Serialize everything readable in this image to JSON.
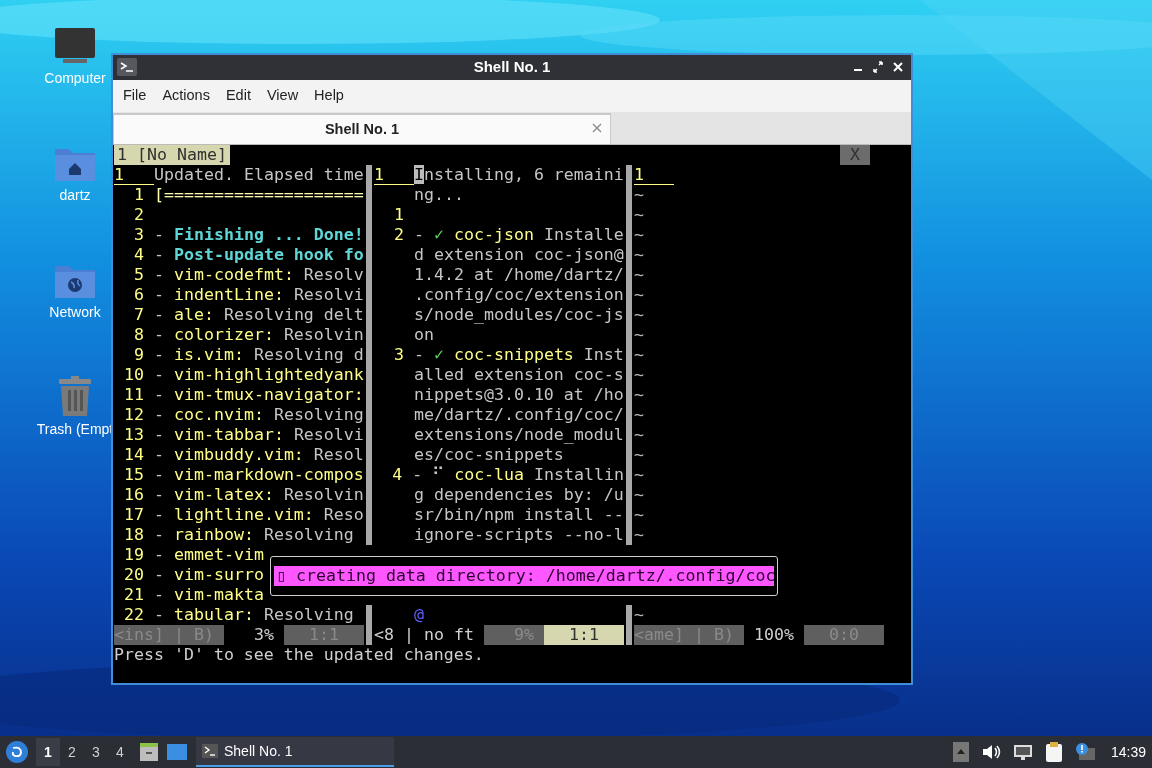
{
  "desktop": {
    "icons": [
      {
        "label": "Computer",
        "kind": "computer"
      },
      {
        "label": "dartz",
        "kind": "home"
      },
      {
        "label": "Network",
        "kind": "network"
      },
      {
        "label": "Trash (Empt",
        "kind": "trash"
      }
    ]
  },
  "window": {
    "title": "Shell No. 1",
    "menu": [
      "File",
      "Actions",
      "Edit",
      "View",
      "Help"
    ],
    "tabs": [
      {
        "label": "Shell No. 1",
        "selected": true
      }
    ],
    "terminal": {
      "tabline": {
        "label": "1 [No Name]",
        "close": "X"
      },
      "panes": [
        {
          "lines": [
            {
              "number": "1",
              "current": true,
              "segments": [
                {
                  "text": "Updated. Elapsed time",
                  "kind": "plain"
                }
              ]
            },
            {
              "number": "1",
              "current": false,
              "segments": [
                {
                  "text": "[====================",
                  "kind": "progress"
                }
              ]
            },
            {
              "number": "2",
              "current": false
            },
            {
              "number": "3",
              "current": false,
              "segments": [
                {
                  "text": "- ",
                  "kind": "plain"
                },
                {
                  "text": "Finishing ... Done!",
                  "kind": "bold"
                }
              ]
            },
            {
              "number": "4",
              "current": false,
              "segments": [
                {
                  "text": "- ",
                  "kind": "plain"
                },
                {
                  "text": "Post-update hook fo",
                  "kind": "bold"
                }
              ]
            },
            {
              "number": "5",
              "current": false,
              "segments": [
                {
                  "text": "- ",
                  "kind": "plain"
                },
                {
                  "text": "vim-codefmt:",
                  "kind": "name"
                },
                {
                  "text": " Resolv",
                  "kind": "plain"
                }
              ]
            },
            {
              "number": "6",
              "current": false,
              "segments": [
                {
                  "text": "- ",
                  "kind": "plain"
                },
                {
                  "text": "indentLine:",
                  "kind": "name"
                },
                {
                  "text": " Resolvi",
                  "kind": "plain"
                }
              ]
            },
            {
              "number": "7",
              "current": false,
              "segments": [
                {
                  "text": "- ",
                  "kind": "plain"
                },
                {
                  "text": "ale:",
                  "kind": "name"
                },
                {
                  "text": " Resolving delt",
                  "kind": "plain"
                }
              ]
            },
            {
              "number": "8",
              "current": false,
              "segments": [
                {
                  "text": "- ",
                  "kind": "plain"
                },
                {
                  "text": "colorizer:",
                  "kind": "name"
                },
                {
                  "text": " Resolvin",
                  "kind": "plain"
                }
              ]
            },
            {
              "number": "9",
              "current": false,
              "segments": [
                {
                  "text": "- ",
                  "kind": "plain"
                },
                {
                  "text": "is.vim:",
                  "kind": "name"
                },
                {
                  "text": " Resolving d",
                  "kind": "plain"
                }
              ]
            },
            {
              "number": "10",
              "current": false,
              "segments": [
                {
                  "text": "- ",
                  "kind": "plain"
                },
                {
                  "text": "vim-highlightedyank",
                  "kind": "name"
                }
              ]
            },
            {
              "number": "11",
              "current": false,
              "segments": [
                {
                  "text": "- ",
                  "kind": "plain"
                },
                {
                  "text": "vim-tmux-navigator:",
                  "kind": "name"
                }
              ]
            },
            {
              "number": "12",
              "current": false,
              "segments": [
                {
                  "text": "- ",
                  "kind": "plain"
                },
                {
                  "text": "coc.nvim:",
                  "kind": "name"
                },
                {
                  "text": " Resolving",
                  "kind": "plain"
                }
              ]
            },
            {
              "number": "13",
              "current": false,
              "segments": [
                {
                  "text": "- ",
                  "kind": "plain"
                },
                {
                  "text": "vim-tabbar:",
                  "kind": "name"
                },
                {
                  "text": " Resolvi",
                  "kind": "plain"
                }
              ]
            },
            {
              "number": "14",
              "current": false,
              "segments": [
                {
                  "text": "- ",
                  "kind": "plain"
                },
                {
                  "text": "vimbuddy.vim:",
                  "kind": "name"
                },
                {
                  "text": " Resol",
                  "kind": "plain"
                }
              ]
            },
            {
              "number": "15",
              "current": false,
              "segments": [
                {
                  "text": "- ",
                  "kind": "plain"
                },
                {
                  "text": "vim-markdown-compos",
                  "kind": "name"
                }
              ]
            },
            {
              "number": "16",
              "current": false,
              "segments": [
                {
                  "text": "- ",
                  "kind": "plain"
                },
                {
                  "text": "vim-latex:",
                  "kind": "name"
                },
                {
                  "text": " Resolvin",
                  "kind": "plain"
                }
              ]
            },
            {
              "number": "17",
              "current": false,
              "segments": [
                {
                  "text": "- ",
                  "kind": "plain"
                },
                {
                  "text": "lightline.vim:",
                  "kind": "name"
                },
                {
                  "text": " Reso",
                  "kind": "plain"
                }
              ]
            },
            {
              "number": "18",
              "current": false,
              "segments": [
                {
                  "text": "- ",
                  "kind": "plain"
                },
                {
                  "text": "rainbow:",
                  "kind": "name"
                },
                {
                  "text": " Resolving",
                  "kind": "plain"
                }
              ]
            },
            {
              "number": "19",
              "current": false,
              "segments": [
                {
                  "text": "- ",
                  "kind": "plain"
                },
                {
                  "text": "emmet-vim",
                  "kind": "name"
                }
              ]
            },
            {
              "number": "20",
              "current": false,
              "segments": [
                {
                  "text": "- ",
                  "kind": "plain"
                },
                {
                  "text": "vim-surro",
                  "kind": "name"
                }
              ]
            },
            {
              "number": "21",
              "current": false,
              "segments": [
                {
                  "text": "- ",
                  "kind": "plain"
                },
                {
                  "text": "vim-makta",
                  "kind": "name"
                }
              ]
            },
            {
              "number": "22",
              "current": false,
              "segments": [
                {
                  "text": "- ",
                  "kind": "plain"
                },
                {
                  "text": "tabular:",
                  "kind": "name"
                },
                {
                  "text": " Resolving",
                  "kind": "plain"
                }
              ]
            }
          ]
        },
        {
          "lines": [
            {
              "number": "1",
              "current": true,
              "segments": [
                {
                  "text": "I",
                  "kind": "cursor"
                },
                {
                  "text": "nstalling, 6 remaini",
                  "kind": "plain"
                }
              ]
            },
            {
              "segments": [
                {
                  "text": "ng...",
                  "kind": "plain"
                }
              ]
            },
            {
              "number": "1",
              "current": false
            },
            {
              "number": "2",
              "current": false,
              "segments": [
                {
                  "text": "- ",
                  "kind": "plain"
                },
                {
                  "text": "✓",
                  "kind": "check"
                },
                {
                  "text": " coc-json",
                  "kind": "name"
                },
                {
                  "text": " Installe",
                  "kind": "plain"
                }
              ]
            },
            {
              "segments": [
                {
                  "text": "d extension coc-json@",
                  "kind": "plain"
                }
              ]
            },
            {
              "segments": [
                {
                  "text": "1.4.2 at /home/dartz/",
                  "kind": "plain"
                }
              ]
            },
            {
              "segments": [
                {
                  "text": ".config/coc/extension",
                  "kind": "plain"
                }
              ]
            },
            {
              "segments": [
                {
                  "text": "s/node_modules/coc-js",
                  "kind": "plain"
                }
              ]
            },
            {
              "segments": [
                {
                  "text": "on",
                  "kind": "plain"
                }
              ]
            },
            {
              "number": "3",
              "current": false,
              "segments": [
                {
                  "text": "- ",
                  "kind": "plain"
                },
                {
                  "text": "✓",
                  "kind": "check"
                },
                {
                  "text": " coc-snippets",
                  "kind": "name"
                },
                {
                  "text": " Inst",
                  "kind": "plain"
                }
              ]
            },
            {
              "segments": [
                {
                  "text": "alled extension coc-s",
                  "kind": "plain"
                }
              ]
            },
            {
              "segments": [
                {
                  "text": "nippets@3.0.10 at /ho",
                  "kind": "plain"
                }
              ]
            },
            {
              "segments": [
                {
                  "text": "me/dartz/.config/coc/",
                  "kind": "plain"
                }
              ]
            },
            {
              "segments": [
                {
                  "text": "extensions/node_modul",
                  "kind": "plain"
                }
              ]
            },
            {
              "segments": [
                {
                  "text": "es/coc-snippets",
                  "kind": "plain"
                }
              ]
            },
            {
              "number": "4",
              "current": false,
              "segments": [
                {
                  "text": "- ⠋",
                  "kind": "plain"
                },
                {
                  "text": " coc-lua",
                  "kind": "name"
                },
                {
                  "text": " Installin",
                  "kind": "plain"
                }
              ]
            },
            {
              "segments": [
                {
                  "text": "g dependencies by: /u",
                  "kind": "plain"
                }
              ]
            },
            {
              "segments": [
                {
                  "text": "sr/bin/npm install --",
                  "kind": "plain"
                }
              ]
            },
            {
              "segments": [
                {
                  "text": "ignore-scripts --no-l",
                  "kind": "plain"
                }
              ]
            },
            {
              "segments": [
                {
                  "text": "@",
                  "kind": "at"
                }
              ]
            }
          ]
        },
        {
          "lines": [
            {
              "number": "1",
              "current": true
            },
            {
              "segments": [
                {
                  "text": "~",
                  "kind": "filler"
                }
              ]
            },
            {
              "segments": [
                {
                  "text": "~",
                  "kind": "filler"
                }
              ]
            },
            {
              "segments": [
                {
                  "text": "~",
                  "kind": "filler"
                }
              ]
            },
            {
              "segments": [
                {
                  "text": "~",
                  "kind": "filler"
                }
              ]
            },
            {
              "segments": [
                {
                  "text": "~",
                  "kind": "filler"
                }
              ]
            },
            {
              "segments": [
                {
                  "text": "~",
                  "kind": "filler"
                }
              ]
            },
            {
              "segments": [
                {
                  "text": "~",
                  "kind": "filler"
                }
              ]
            },
            {
              "segments": [
                {
                  "text": "~",
                  "kind": "filler"
                }
              ]
            },
            {
              "segments": [
                {
                  "text": "~",
                  "kind": "filler"
                }
              ]
            },
            {
              "segments": [
                {
                  "text": "~",
                  "kind": "filler"
                }
              ]
            },
            {
              "segments": [
                {
                  "text": "~",
                  "kind": "filler"
                }
              ]
            },
            {
              "segments": [
                {
                  "text": "~",
                  "kind": "filler"
                }
              ]
            },
            {
              "segments": [
                {
                  "text": "~",
                  "kind": "filler"
                }
              ]
            },
            {
              "segments": [
                {
                  "text": "~",
                  "kind": "filler"
                }
              ]
            },
            {
              "segments": [
                {
                  "text": "~",
                  "kind": "filler"
                }
              ]
            },
            {
              "segments": [
                {
                  "text": "~",
                  "kind": "filler"
                }
              ]
            },
            {
              "segments": [
                {
                  "text": "~",
                  "kind": "filler"
                }
              ]
            },
            {
              "segments": [
                {
                  "text": "~",
                  "kind": "filler"
                }
              ]
            },
            {
              "segments": [
                {
                  "text": "~",
                  "kind": "filler"
                }
              ]
            }
          ]
        }
      ],
      "status": [
        {
          "mode": "<ins] | B)",
          "percent": "3%",
          "position": "1:1",
          "active": false
        },
        {
          "mode": "<8 | no ft",
          "percent": "9%",
          "position": "1:1",
          "active": true
        },
        {
          "mode": "<ame] | B)",
          "percent": "100%",
          "position": "0:0",
          "active": false
        }
      ],
      "popup": "▯ creating data directory: /home/dartz/.config/coc",
      "command_line": "Press 'D' to see the updated changes."
    }
  },
  "taskbar": {
    "workspaces": [
      {
        "label": "1",
        "selected": true
      },
      {
        "label": "2",
        "selected": false
      },
      {
        "label": "3",
        "selected": false
      },
      {
        "label": "4",
        "selected": false
      }
    ],
    "tasks": [
      {
        "label": "Shell No. 1",
        "selected": true
      }
    ],
    "clock": "14:39"
  }
}
